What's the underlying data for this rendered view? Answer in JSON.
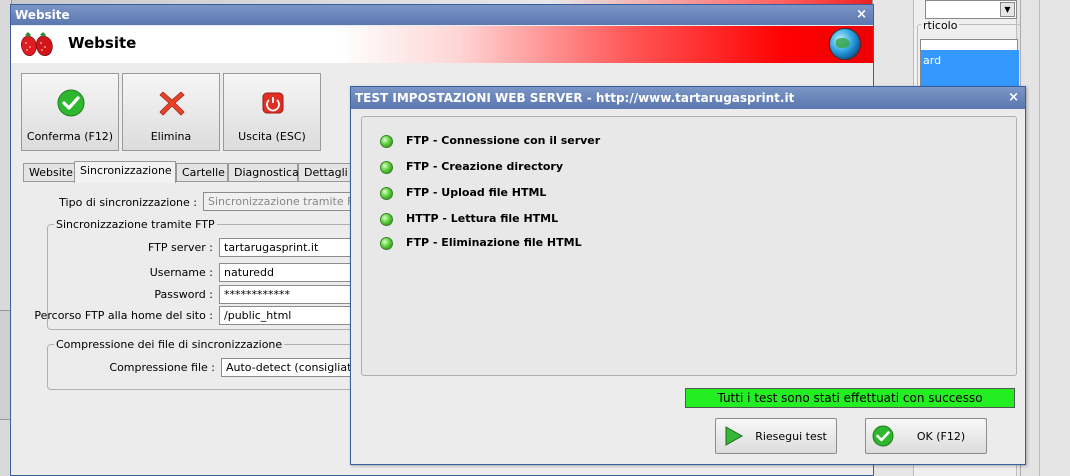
{
  "main_window": {
    "title": "Website",
    "close_glyph": "×",
    "banner_title": "Website",
    "toolbar": {
      "confirm_label": "Conferma (F12)",
      "delete_label": "Elimina",
      "exit_label": "Uscita (ESC)"
    },
    "tabs": [
      "Website",
      "Sincronizzazione",
      "Cartelle",
      "Diagnostica",
      "Dettagli ultim"
    ],
    "active_tab": "Sincronizzazione",
    "sync": {
      "type_label": "Tipo di sincronizzazione :",
      "type_value": "Sincronizzazione tramite FTP/H",
      "ftp_group_title": "Sincronizzazione tramite FTP",
      "ftp_server_label": "FTP server :",
      "ftp_server_value": "tartarugasprint.it",
      "username_label": "Username :",
      "username_value": "naturedd",
      "password_label": "Password :",
      "password_value": "************",
      "path_label": "Percorso FTP alla home del sito :",
      "path_value": "/public_html",
      "compression_group_title": "Compressione dei file di sincronizzazione",
      "compression_label": "Compressione file :",
      "compression_value": "Auto-detect (consigliato)"
    }
  },
  "background": {
    "right_list_label": "rticolo",
    "right_list_selected": "ard"
  },
  "dialog": {
    "title": "TEST IMPOSTAZIONI WEB SERVER - http://www.tartarugasprint.it",
    "close_glyph": "×",
    "tests": [
      {
        "label": "FTP - Connessione con il server",
        "status": "ok"
      },
      {
        "label": "FTP - Creazione directory",
        "status": "ok"
      },
      {
        "label": "FTP - Upload file HTML",
        "status": "ok"
      },
      {
        "label": "HTTP - Lettura file HTML",
        "status": "ok"
      },
      {
        "label": "FTP - Eliminazione file HTML",
        "status": "ok"
      }
    ],
    "result_text": "Tutti i test sono stati effettuati con successo",
    "rerun_label": "Riesegui test",
    "ok_label": "OK (F12)"
  },
  "colors": {
    "titlebar": "#5a77b0",
    "success_bar": "#22ee22",
    "led_ok": "#5ed13c",
    "banner_red": "#ff0000"
  },
  "icons": {
    "confirm": "check-circle-icon",
    "delete": "red-x-icon",
    "exit": "power-icon",
    "rerun": "play-icon",
    "ok": "check-circle-icon",
    "banner_logo": "strawberry-icon",
    "banner_globe": "globe-icon"
  }
}
